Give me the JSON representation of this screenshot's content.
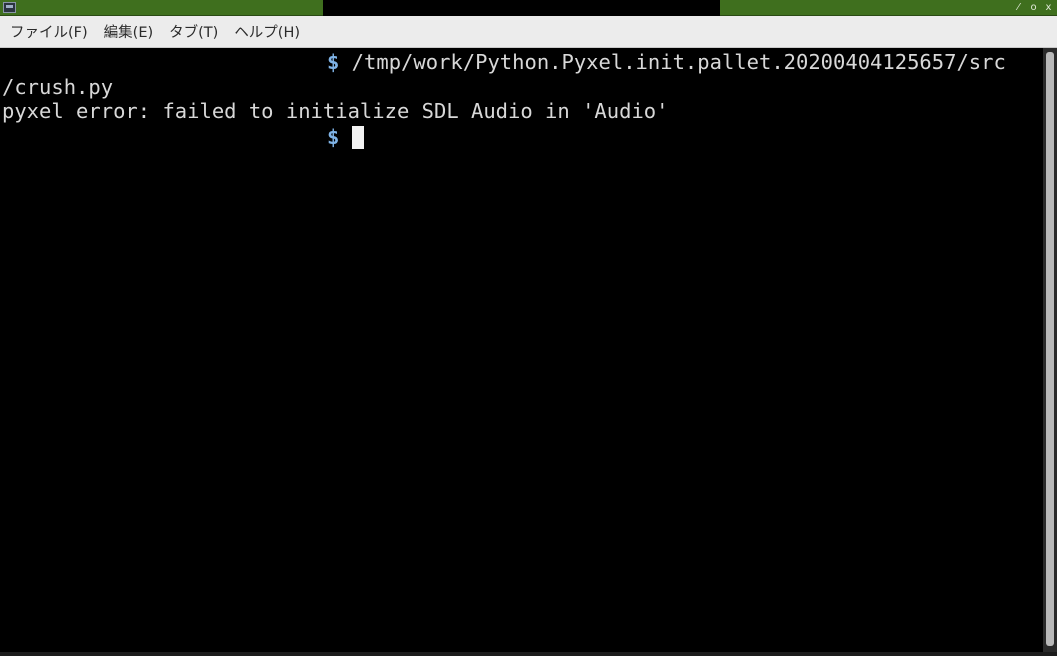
{
  "window": {
    "icon": "terminal-icon",
    "controls": [
      "⁄",
      "o",
      "x"
    ],
    "titlebar_color": "#3f6f1e"
  },
  "menu": {
    "items": [
      "ファイル(F)",
      "編集(E)",
      "タブ(T)",
      "ヘルプ(H)"
    ]
  },
  "terminal": {
    "prompt_symbol": "$",
    "line1_command": " /tmp/work/Python.Pyxel.init.pallet.20200404125657/src",
    "line2": "/crush.py",
    "line3": "pyxel error: failed to initialize SDL Audio in 'Audio'",
    "line4_command": " ",
    "prompt_color": "#7fb3e6",
    "text_color": "#d8d8d8"
  }
}
